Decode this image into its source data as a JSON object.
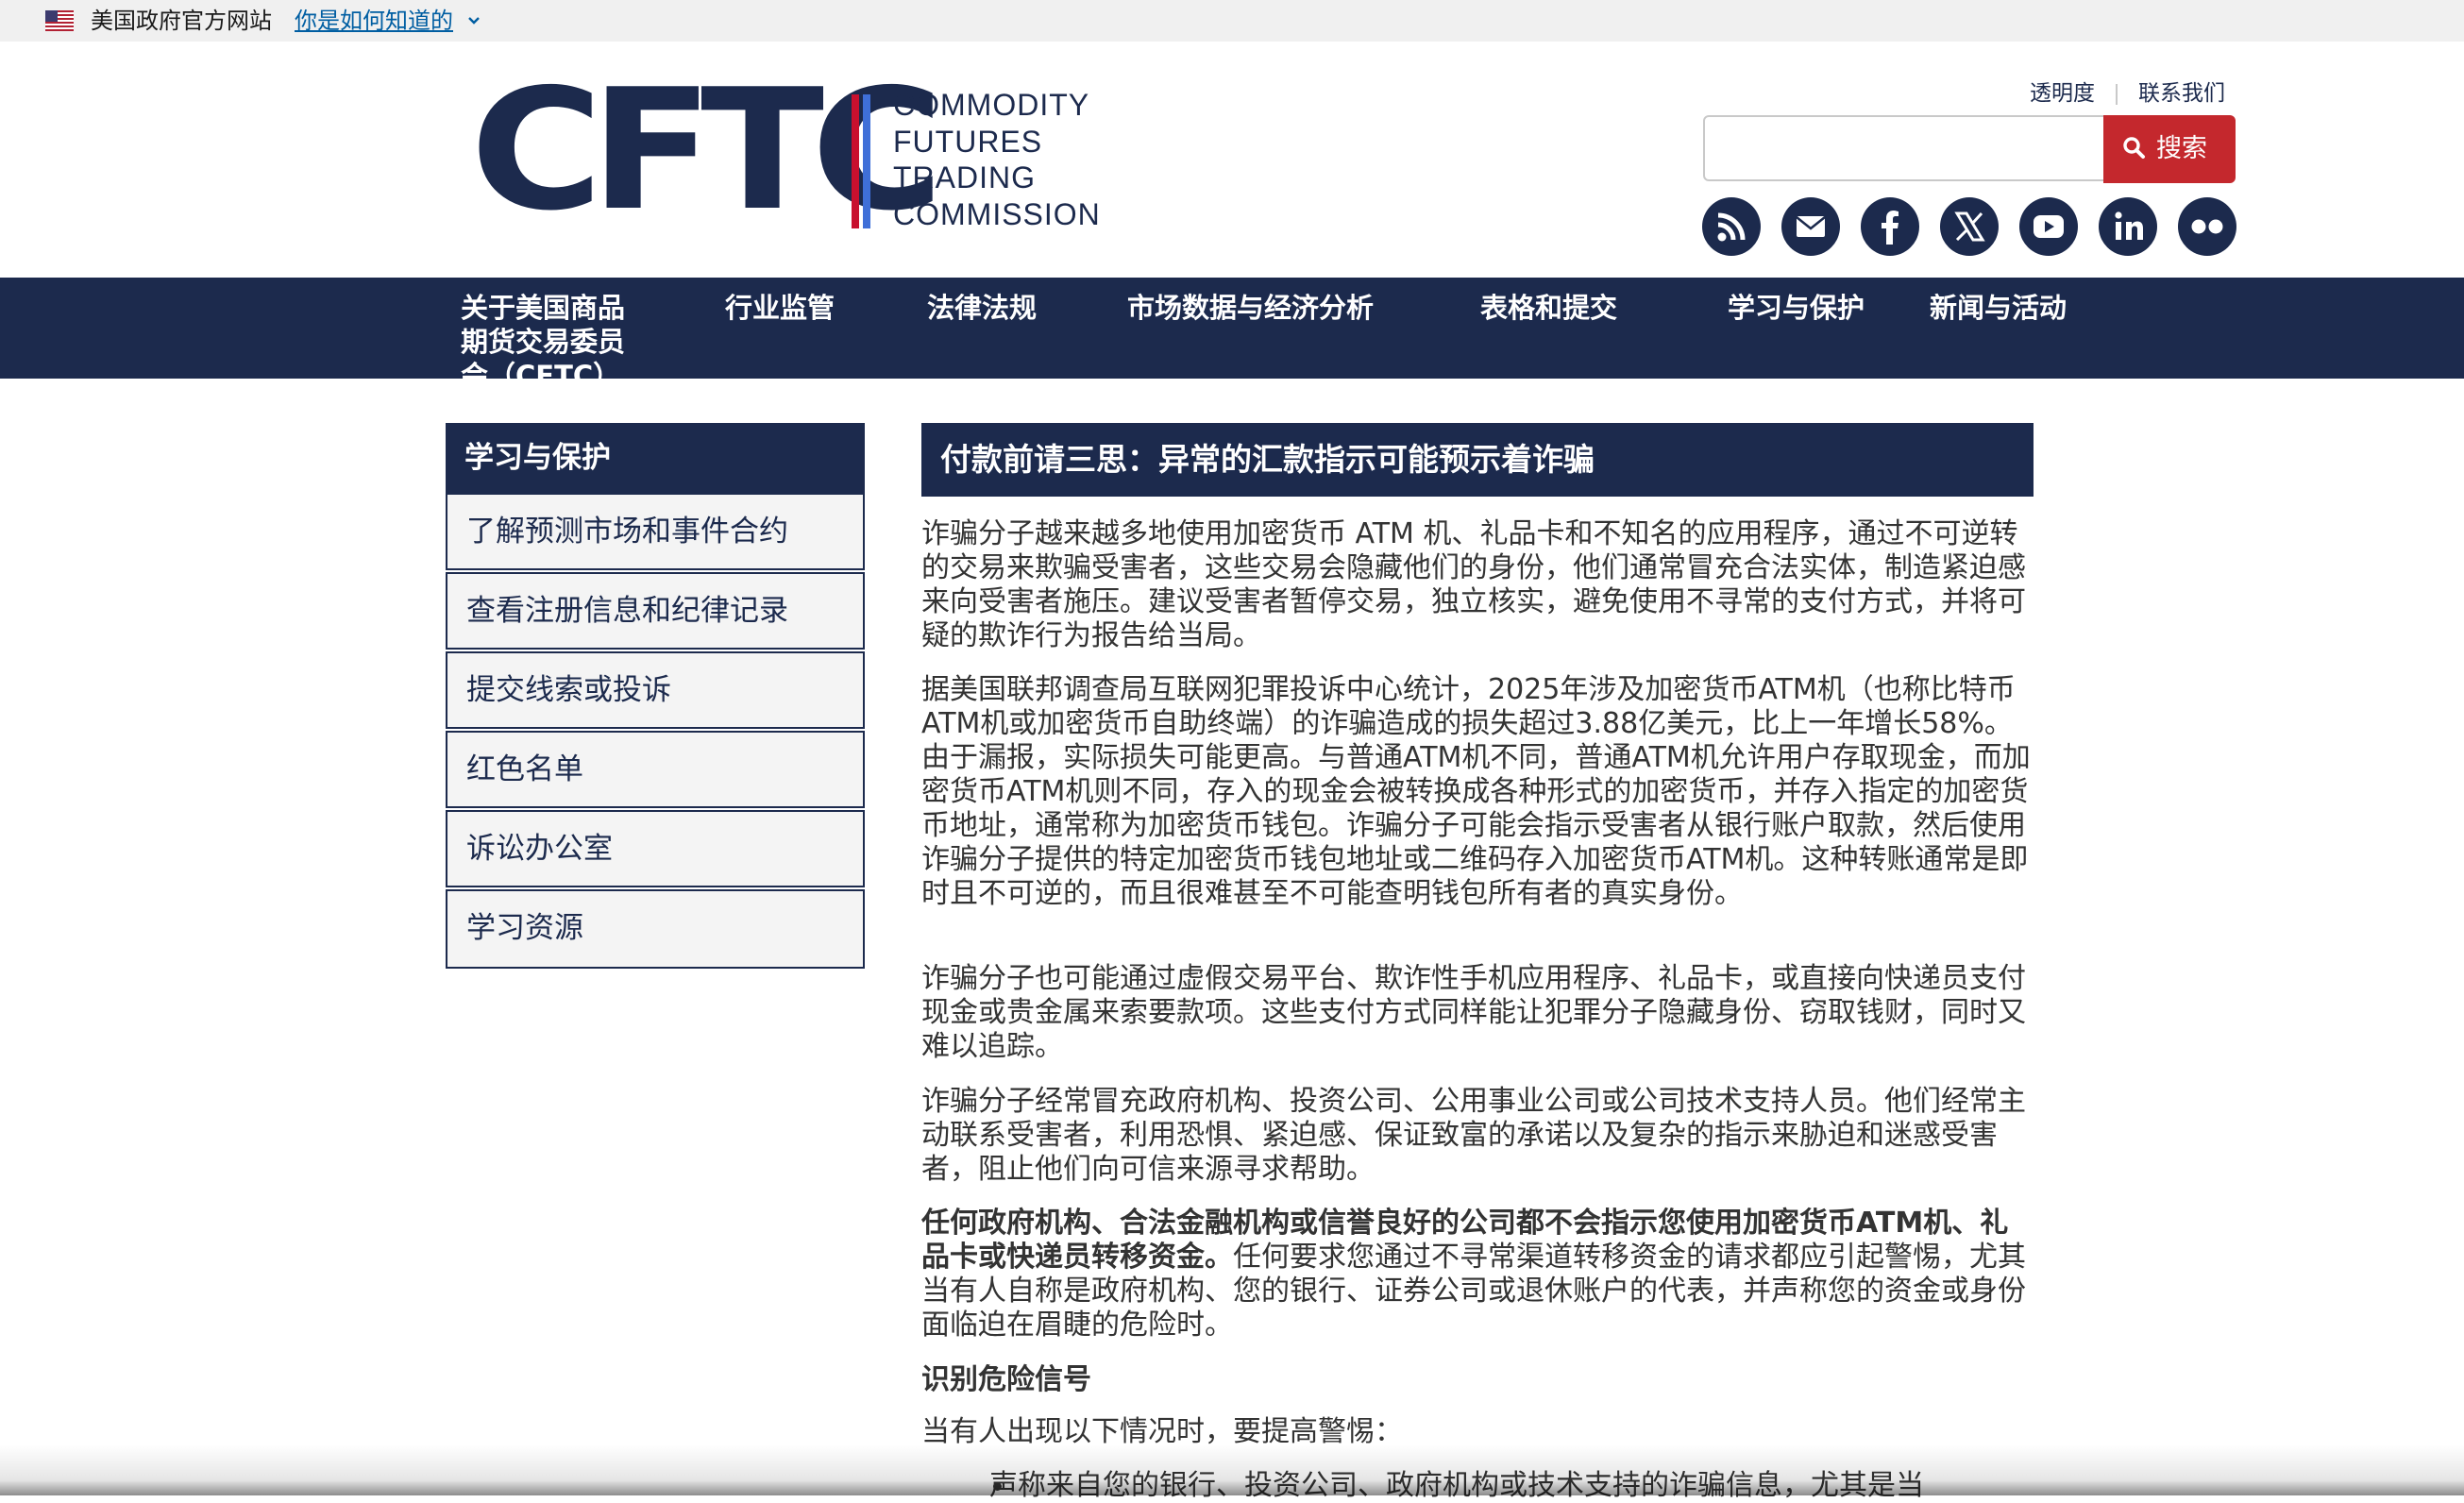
{
  "gov_banner": {
    "text": "美国政府官方网站",
    "link": "你是如何知道的"
  },
  "logo": {
    "acronym": "CFTC",
    "line1": "COMMODITY",
    "line2": "FUTURES",
    "line3": "TRADING",
    "line4": "COMMISSION"
  },
  "utility": {
    "transparency": "透明度",
    "contact": "联系我们"
  },
  "search": {
    "placeholder": "",
    "button_label": "搜索"
  },
  "social_icons": [
    "rss-icon",
    "email-icon",
    "facebook-icon",
    "x-icon",
    "youtube-icon",
    "linkedin-icon",
    "flickr-icon"
  ],
  "nav": {
    "items": [
      {
        "label": "关于美国商品期货交易委员会（CFTC）"
      },
      {
        "label": "行业监管"
      },
      {
        "label": "法律法规"
      },
      {
        "label": "市场数据与经济分析"
      },
      {
        "label": "表格和提交"
      },
      {
        "label": "学习与保护"
      },
      {
        "label": "新闻与活动"
      }
    ]
  },
  "sidebar": {
    "title": "学习与保护",
    "items": [
      {
        "label": "了解预测市场和事件合约"
      },
      {
        "label": "查看注册信息和纪律记录"
      },
      {
        "label": "提交线索或投诉"
      },
      {
        "label": "红色名单"
      },
      {
        "label": "诉讼办公室"
      },
      {
        "label": "学习资源"
      }
    ]
  },
  "main": {
    "title": "付款前请三思：异常的汇款指示可能预示着诈骗",
    "p1": "诈骗分子越来越多地使用加密货币 ATM 机、礼品卡和不知名的应用程序，通过不可逆转的交易来欺骗受害者，这些交易会隐藏他们的身份，他们通常冒充合法实体，制造紧迫感来向受害者施压。建议受害者暂停交易，独立核实，避免使用不寻常的支付方式，并将可疑的欺诈行为报告给当局。",
    "p2": "据美国联邦调查局互联网犯罪投诉中心统计，2025年涉及加密货币ATM机（也称比特币ATM机或加密货币自助终端）的诈骗造成的损失超过3.88亿美元，比上一年增长58%。由于漏报，实际损失可能更高。与普通ATM机不同，普通ATM机允许用户存取现金，而加密货币ATM机则不同，存入的现金会被转换成各种形式的加密货币，并存入指定的加密货币地址，通常称为加密货币钱包。诈骗分子可能会指示受害者从银行账户取款，然后使用诈骗分子提供的特定加密货币钱包地址或二维码存入加密货币ATM机。这种转账通常是即时且不可逆的，而且很难甚至不可能查明钱包所有者的真实身份。",
    "p3": "诈骗分子也可能通过虚假交易平台、欺诈性手机应用程序、礼品卡，或直接向快递员支付现金或贵金属来索要款项。这些支付方式同样能让犯罪分子隐藏身份、窃取钱财，同时又难以追踪。",
    "p4": "诈骗分子经常冒充政府机构、投资公司、公用事业公司或公司技术支持人员。他们经常主动联系受害者，利用恐惧、紧迫感、保证致富的承诺以及复杂的指示来胁迫和迷惑受害者，阻止他们向可信来源寻求帮助。",
    "p5_bold": "任何政府机构、合法金融机构或信誉良好的公司都不会指示您使用加密货币ATM机、礼品卡或快递员转移资金。",
    "p5_rest": "任何要求您通过不寻常渠道转移资金的请求都应引起警惕，尤其当有人自称是政府机构、您的银行、证券公司或退休账户的代表，并声称您的资金或身份面临迫在眉睫的危险时。",
    "subhead": "识别危险信号",
    "p6": "当有人出现以下情况时，要提高警惕：",
    "bullet1": "声称来自您的银行、投资公司、政府机构或技术支持的诈骗信息，尤其是当"
  }
}
